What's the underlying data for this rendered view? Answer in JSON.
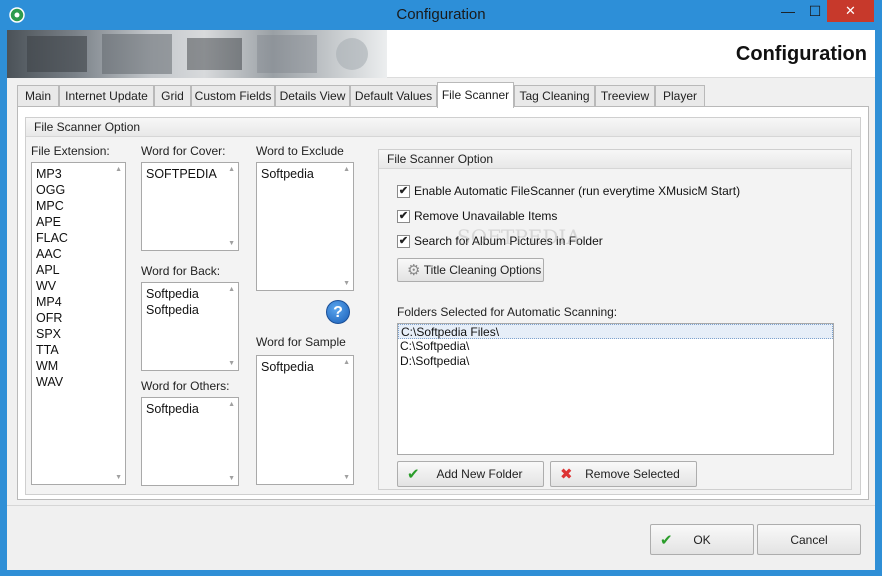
{
  "window": {
    "title": "Configuration",
    "minimize": "—",
    "maximize": "☐",
    "close": "✕"
  },
  "banner": {
    "heading": "Configuration"
  },
  "tabs": [
    "Main",
    "Internet Update",
    "Grid",
    "Custom Fields",
    "Details View",
    "Default Values",
    "File Scanner",
    "Tag Cleaning",
    "Treeview",
    "Player"
  ],
  "active_tab": "File Scanner",
  "outer_group": {
    "title": "File Scanner Option"
  },
  "file_extension": {
    "label": "File Extension:",
    "items": [
      "MP3",
      "OGG",
      "MPC",
      "APE",
      "FLAC",
      "AAC",
      "APL",
      "WV",
      "MP4",
      "OFR",
      "SPX",
      "TTA",
      "WM",
      "WAV"
    ]
  },
  "word_for_cover": {
    "label": "Word for Cover:",
    "items": [
      "SOFTPEDIA"
    ]
  },
  "word_for_back": {
    "label": "Word for Back:",
    "items": [
      "Softpedia",
      "Softpedia"
    ]
  },
  "word_for_others": {
    "label": "Word for Others:",
    "items": [
      "Softpedia"
    ]
  },
  "word_to_exclude": {
    "label": "Word to Exclude",
    "items": [
      "Softpedia"
    ]
  },
  "word_for_sample": {
    "label": "Word for Sample",
    "items": [
      "Softpedia"
    ]
  },
  "help": {
    "glyph": "?"
  },
  "inner_group": {
    "title": "File Scanner Option",
    "checks": [
      {
        "label": "Enable Automatic FileScanner (run everytime XMusicM Start)",
        "checked": true
      },
      {
        "label": "Remove Unavailable Items",
        "checked": true
      },
      {
        "label": "Search for Album Pictures in Folder",
        "checked": true
      }
    ],
    "title_cleaning_button": "Title Cleaning Options",
    "folders_label": "Folders Selected for Automatic Scanning:",
    "folders": [
      "C:\\Softpedia Files\\",
      "C:\\Softpedia\\",
      "D:\\Softpedia\\"
    ],
    "add_folder_button": "Add New Folder",
    "remove_button": "Remove Selected"
  },
  "footer": {
    "ok": "OK",
    "cancel": "Cancel"
  },
  "watermark": "SOFTPEDIA",
  "colors": {
    "titlebar": "#2d8fd8",
    "close": "#c7392b",
    "check_ok": "#2a9d2a",
    "cross": "#dd3333"
  },
  "icons": {
    "check": "✔",
    "cross": "✖",
    "gear": "⚙",
    "ok_tick": "✔"
  }
}
